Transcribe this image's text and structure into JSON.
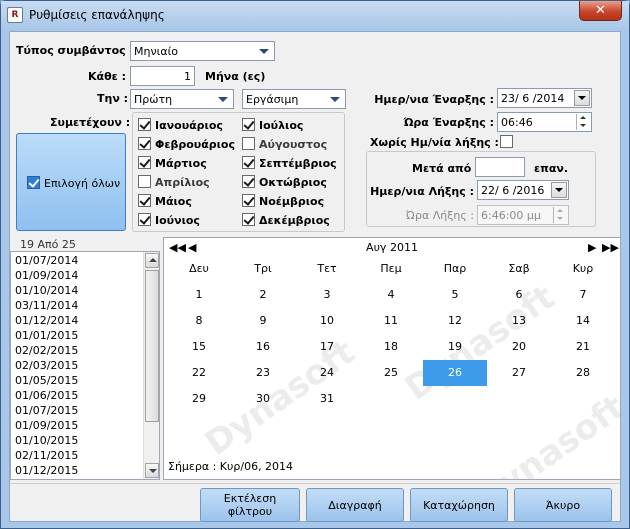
{
  "window": {
    "title": "Ρυθμίσεις επανάληψης",
    "icon_text": "R",
    "close_symbol": "✕"
  },
  "form": {
    "event_type_label": "Τύπος συμβάντος :",
    "event_type_value": "Μηνιαίο",
    "every_label": "Κάθε :",
    "every_value": "1",
    "every_unit": "Μήνα (ες)",
    "the_label": "Την :",
    "ordinal_value": "Πρώτη",
    "daytype_value": "Εργάσιμη",
    "participate_label": "Συμετέχουν :",
    "select_all_label": "Επιλογή όλων",
    "select_all_checked": true,
    "months": [
      {
        "label": "Ιανουάριος",
        "checked": true
      },
      {
        "label": "Φεβρουάριος",
        "checked": true
      },
      {
        "label": "Μάρτιος",
        "checked": true
      },
      {
        "label": "Απρίλιος",
        "checked": false
      },
      {
        "label": "Μάιος",
        "checked": true
      },
      {
        "label": "Ιούνιος",
        "checked": true
      },
      {
        "label": "Ιούλιος",
        "checked": true
      },
      {
        "label": "Αύγουστος",
        "checked": false
      },
      {
        "label": "Σεπτέμβριος",
        "checked": true
      },
      {
        "label": "Οκτώβριος",
        "checked": true
      },
      {
        "label": "Νοέμβριος",
        "checked": true
      },
      {
        "label": "Δεκέμβριος",
        "checked": true
      }
    ],
    "start_date_label": "Ημερ/νια Έναρξης :",
    "start_date_value": "23/ 6 /2014",
    "start_time_label": "Ώρα Έναρξης :",
    "start_time_value": "06:46",
    "no_end_label": "Χωρίς Ημ/νία λήξης :",
    "no_end_checked": false,
    "after_label": "Μετά από",
    "after_value": "",
    "after_unit": "επαν.",
    "end_date_label": "Ημερ/νια Λήξης :",
    "end_date_value": "22/ 6 /2016",
    "end_time_label": "Ώρα Λήξης :",
    "end_time_value": "6:46:00 μμ"
  },
  "list": {
    "header": "19 Από 25",
    "items": [
      "01/07/2014",
      "01/09/2014",
      "01/10/2014",
      "03/11/2014",
      "01/12/2014",
      "01/01/2015",
      "02/02/2015",
      "02/03/2015",
      "01/05/2015",
      "01/06/2015",
      "01/07/2015",
      "01/09/2015",
      "01/10/2015",
      "02/11/2015",
      "01/12/2015"
    ]
  },
  "calendar": {
    "month_label": "Αυγ 2011",
    "nav_prev_year": "◀◀",
    "nav_prev": "◀",
    "nav_next": "▶",
    "nav_next_year": "▶▶",
    "weekdays": [
      "Δευ",
      "Τρι",
      "Τετ",
      "Πεμ",
      "Παρ",
      "Σαβ",
      "Κυρ"
    ],
    "weeks": [
      [
        "1",
        "2",
        "3",
        "4",
        "5",
        "6",
        "7"
      ],
      [
        "8",
        "9",
        "10",
        "11",
        "12",
        "13",
        "14"
      ],
      [
        "15",
        "16",
        "17",
        "18",
        "19",
        "20",
        "21"
      ],
      [
        "22",
        "23",
        "24",
        "25",
        "26",
        "27",
        "28"
      ],
      [
        "29",
        "30",
        "31",
        "",
        "",
        "",
        ""
      ]
    ],
    "selected_day": "26",
    "today_text": "Σήμερα : Κυρ/06, 2014",
    "watermark_text": "Dynasoft"
  },
  "buttons": {
    "run_filter": "Εκτέλεση φίλτρου",
    "delete": "Διαγραφή",
    "save": "Καταχώρηση",
    "cancel": "Άκυρο"
  },
  "colors": {
    "window_frame": "#a9c7e8",
    "selected_day_bg": "#3d9be9",
    "button_bg": "#9cc3ec",
    "close_button": "#c8462c"
  }
}
